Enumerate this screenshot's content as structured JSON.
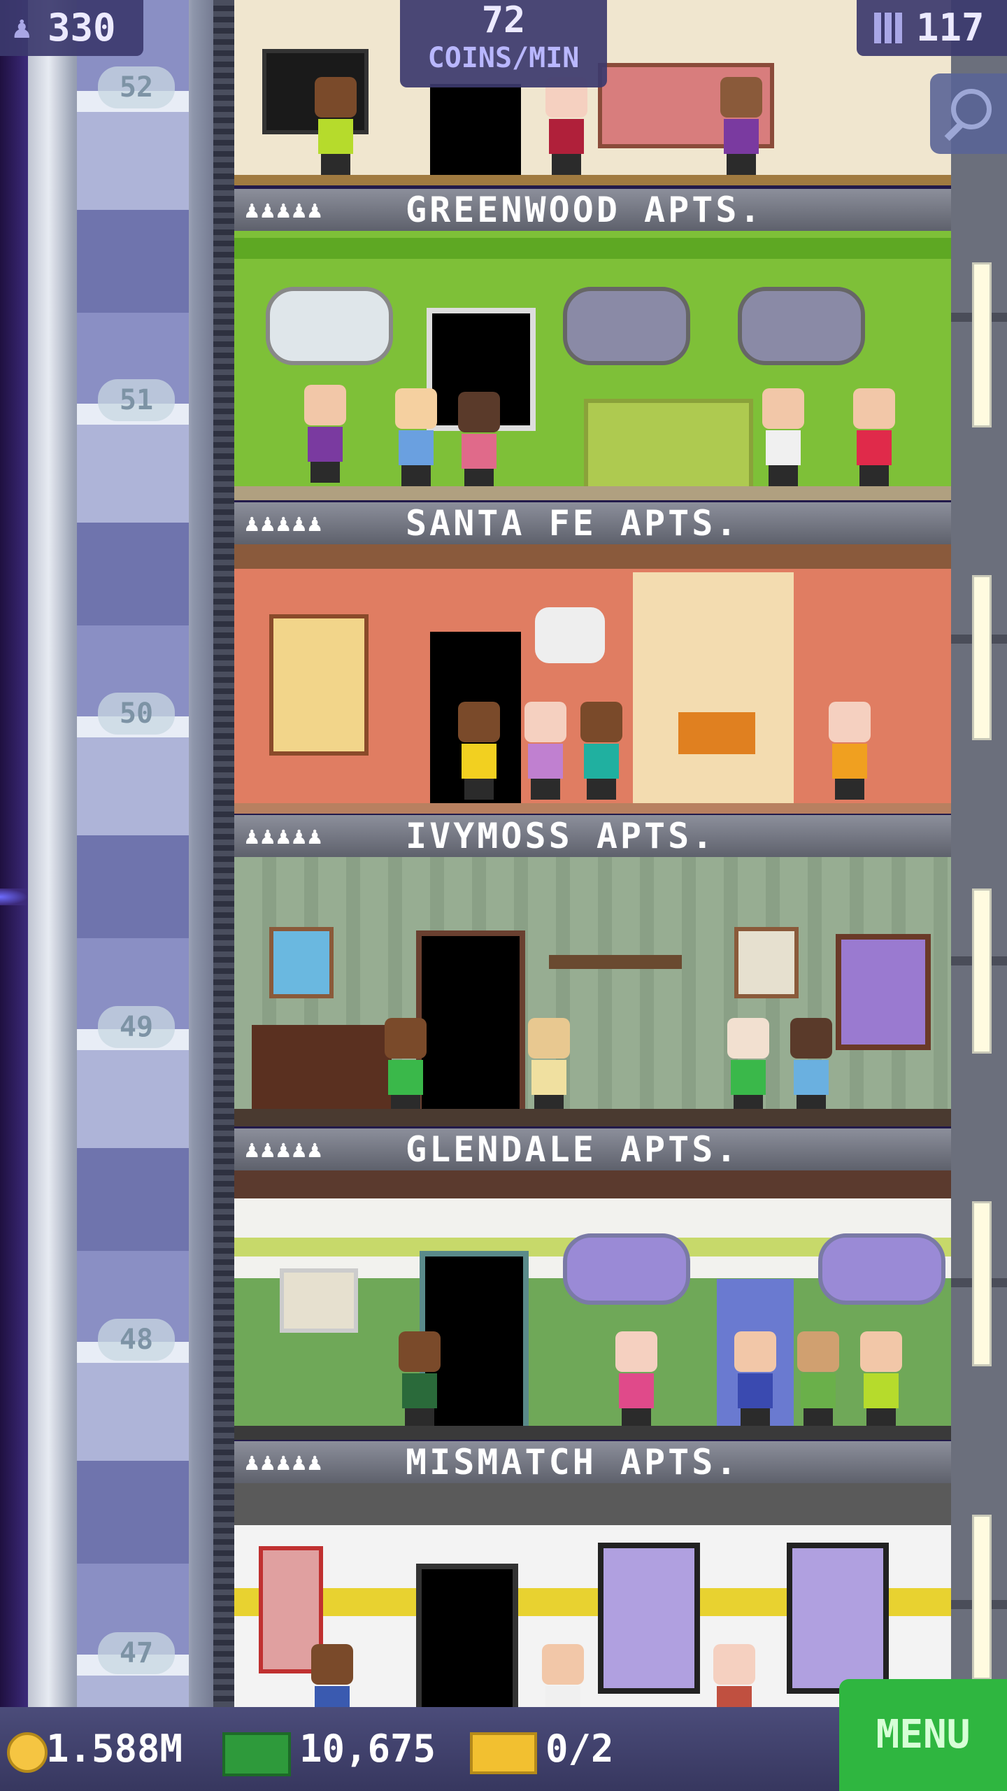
{
  "hud": {
    "population": "330",
    "coins_rate_value": "72",
    "coins_rate_unit": "COINS/MIN",
    "floors_count": "117",
    "coins": "1.588M",
    "bux": "10,675",
    "vip": "0/2",
    "menu_label": "MENU"
  },
  "icons": {
    "population": "person-icon",
    "floors": "building-icon",
    "search": "magnifier-icon",
    "coin": "coin-icon",
    "bux": "bux-icon",
    "vip": "vip-ticket-icon"
  },
  "floor_numbers": [
    "52",
    "51",
    "50",
    "49",
    "48",
    "47"
  ],
  "floors": [
    {
      "name": "GREENWOOD APTS.",
      "pips": "♟♟♟♟♟",
      "wall": "#7ec038",
      "trim": "#5ea823"
    },
    {
      "name": "SANTA FE APTS.",
      "pips": "♟♟♟♟♟",
      "wall": "#e07d62",
      "trim": "#8a5a3c"
    },
    {
      "name": "IVYMOSS APTS.",
      "pips": "♟♟♟♟♟",
      "wall": "#97ad92",
      "trim": "#7c8f78"
    },
    {
      "name": "GLENDALE APTS.",
      "pips": "♟♟♟♟♟",
      "wall": "#c7d96a",
      "trim": "#5b3a2e"
    },
    {
      "name": "MISMATCH APTS.",
      "pips": "♟♟♟♟♟",
      "wall": "#f3f3f3",
      "trim": "#e8d230"
    }
  ],
  "colors": {
    "hud_bg": "#3c3a6e",
    "menu_bg": "#2fb640",
    "coin": "#f5c542",
    "bux": "#2e9a3b"
  }
}
